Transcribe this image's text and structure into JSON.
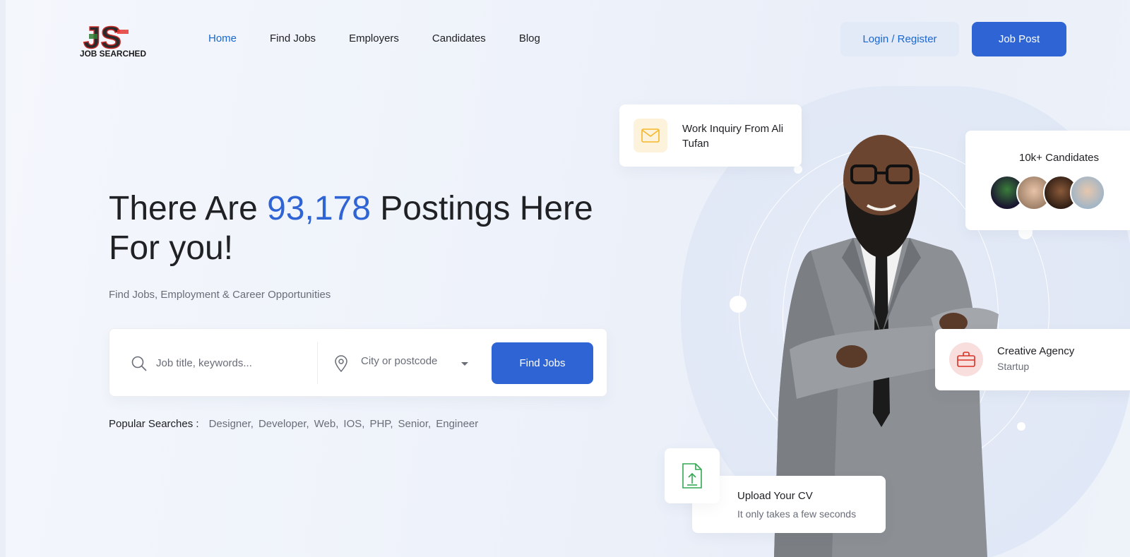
{
  "brand": {
    "logo_letters": "JS",
    "logo_text": "JOB SEARCHED"
  },
  "nav": {
    "items": [
      {
        "label": "Home",
        "active": true
      },
      {
        "label": "Find Jobs",
        "active": false
      },
      {
        "label": "Employers",
        "active": false
      },
      {
        "label": "Candidates",
        "active": false
      },
      {
        "label": "Blog",
        "active": false
      }
    ]
  },
  "header": {
    "login_label": "Login / Register",
    "post_label": "Job Post"
  },
  "hero": {
    "title_prefix": "There Are ",
    "title_count": "93,178",
    "title_suffix": " Postings Here For you!",
    "subtitle": "Find Jobs, Employment & Career Opportunities"
  },
  "search": {
    "keyword_placeholder": "Job title, keywords...",
    "keyword_value": "",
    "city_value": "City or postcode",
    "button_label": "Find Jobs"
  },
  "popular": {
    "label": "Popular Searches :",
    "tags": [
      "Designer,",
      "Developer,",
      "Web,",
      "IOS,",
      "PHP,",
      "Senior,",
      "Engineer"
    ]
  },
  "cards": {
    "work_inquiry": "Work Inquiry From Ali Tufan",
    "candidates": "10k+ Candidates",
    "agency_title": "Creative Agency",
    "agency_sub": "Startup",
    "upload_title": "Upload Your CV",
    "upload_sub": "It only takes a few seconds"
  },
  "colors": {
    "accent": "#2f64d4",
    "active_nav": "#1967d2",
    "login_bg": "#e2eaf8",
    "mail_icon_bg": "#fdf3dc",
    "mail_icon": "#f5b729",
    "briefcase_icon_bg": "#f9dede",
    "briefcase_icon": "#d93025",
    "upload_icon": "#34a853"
  },
  "icons": {
    "search": "search-icon",
    "location": "map-pin-icon",
    "caret": "chevron-down-icon",
    "mail": "mail-icon",
    "briefcase": "briefcase-icon",
    "upload": "upload-file-icon"
  }
}
